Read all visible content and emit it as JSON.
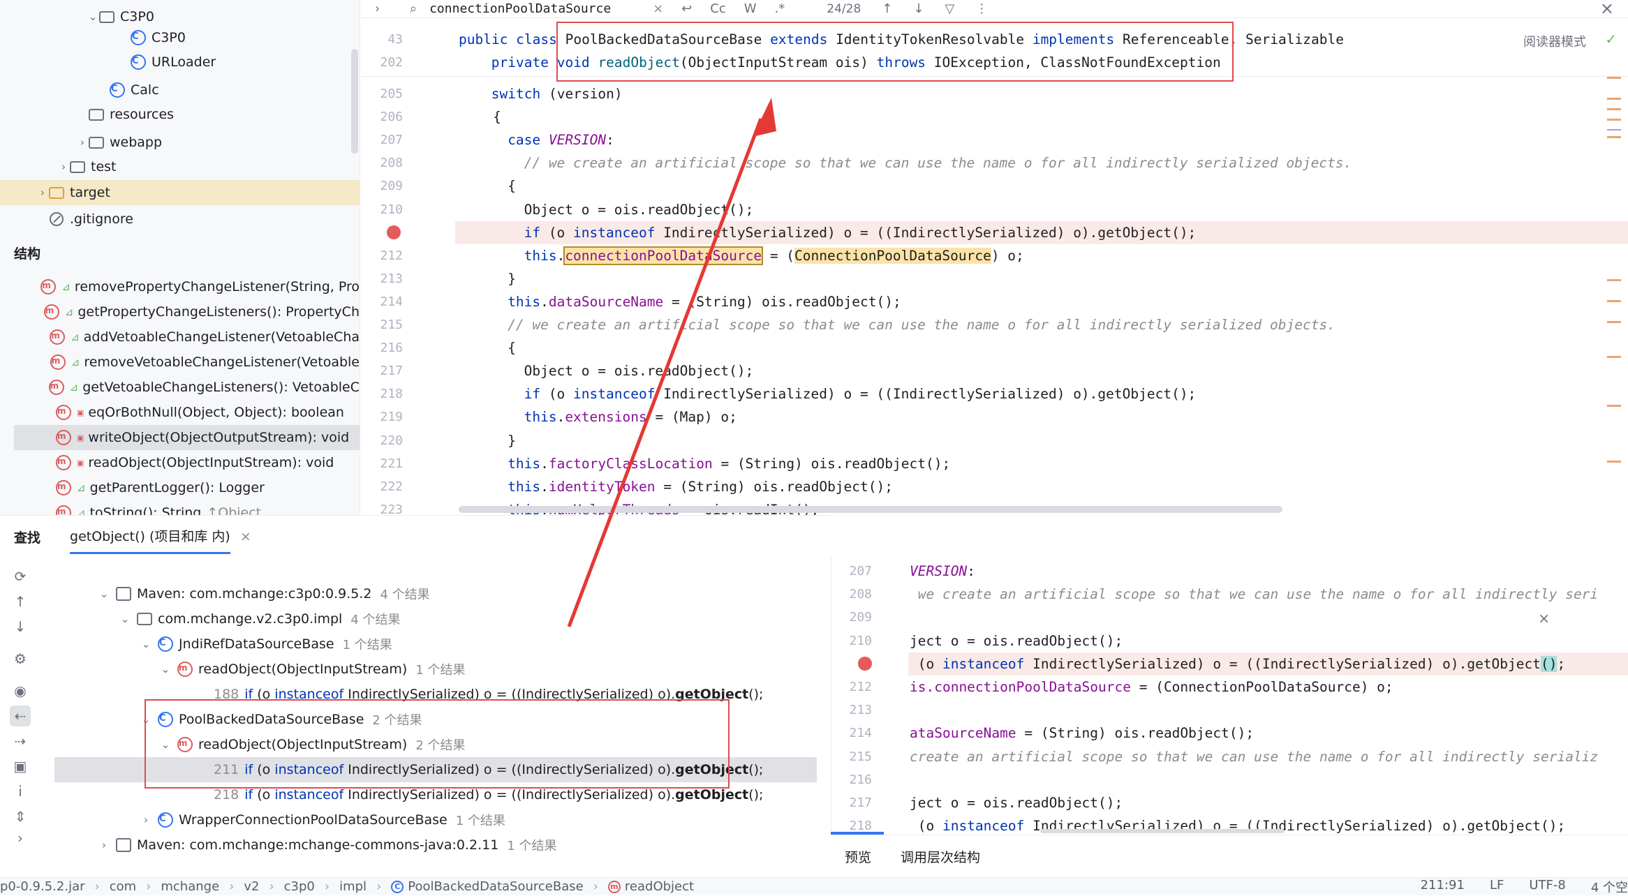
{
  "project_tree": [
    {
      "label": "C3P0",
      "type": "package",
      "indent": 150,
      "chev": "⌄"
    },
    {
      "label": "C3P0",
      "type": "class",
      "indent": 195,
      "chev": ""
    },
    {
      "label": "URLoader",
      "type": "class",
      "indent": 195,
      "chev": ""
    },
    {
      "label": "Calc",
      "type": "class",
      "indent": 165,
      "chev": ""
    },
    {
      "label": "resources",
      "type": "folder",
      "indent": 135,
      "chev": ""
    },
    {
      "label": "webapp",
      "type": "folder",
      "indent": 135,
      "chev": "›"
    },
    {
      "label": "test",
      "type": "folder",
      "indent": 108,
      "chev": "›"
    },
    {
      "label": "target",
      "type": "folder-orange",
      "indent": 78,
      "chev": "›",
      "selected": true
    },
    {
      "label": ".gitignore",
      "type": "git",
      "indent": 78,
      "chev": ""
    }
  ],
  "structure": {
    "title": "结构",
    "items": [
      {
        "label": "removePropertyChangeListener(String, Pro",
        "vis": "pub"
      },
      {
        "label": "getPropertyChangeListeners(): PropertyCh",
        "vis": "pub"
      },
      {
        "label": "addVetoableChangeListener(VetoableCha",
        "vis": "pub"
      },
      {
        "label": "removeVetoableChangeListener(Vetoable",
        "vis": "pub"
      },
      {
        "label": "getVetoableChangeListeners(): VetoableC",
        "vis": "pub"
      },
      {
        "label": "eqOrBothNull(Object, Object): boolean",
        "vis": "prv"
      },
      {
        "label": "writeObject(ObjectOutputStream): void",
        "vis": "prv",
        "selected": true
      },
      {
        "label": "readObject(ObjectInputStream): void",
        "vis": "prv"
      },
      {
        "label": "getParentLogger(): Logger",
        "vis": "pub"
      },
      {
        "label": "toString(): String",
        "vis": "pub",
        "suffix": "↑Object"
      }
    ]
  },
  "search": {
    "query": "connectionPoolDataSource",
    "count": "24/28",
    "opts": [
      "Cc",
      "W",
      ".*"
    ],
    "reader_mode": "阅读器模式"
  },
  "sticky": [
    {
      "ln": "43",
      "html": "<span class=\"kw\">public class</span> PoolBackedDataSourceBase <span class=\"kw\">extends</span> IdentityTokenResolvable <span class=\"kw\">implements</span> Referenceable, Serializable",
      "indent": 0
    },
    {
      "ln": "202",
      "html": "<span class=\"kw\">private void</span> <span class=\"mcall\">readObject</span>(ObjectInputStream ois) <span class=\"kw\">throws</span> IOException, ClassNotFoundException",
      "indent": 2
    }
  ],
  "code": [
    {
      "ln": "205",
      "html": "<span class=\"kw\">switch</span> (version)",
      "indent": 4
    },
    {
      "ln": "206",
      "html": "{",
      "indent": 4.2
    },
    {
      "ln": "207",
      "html": "<span class=\"kw\">case</span> <span class=\"const\">VERSION</span>:",
      "indent": 6
    },
    {
      "ln": "208",
      "html": "<span class=\"cm\">// we create an artificial scope so that we can use the name o for all indirectly serialized objects.</span>",
      "indent": 8
    },
    {
      "ln": "209",
      "html": "{",
      "indent": 6
    },
    {
      "ln": "210",
      "html": "Object o = ois.readObject();",
      "indent": 8
    },
    {
      "ln": "",
      "html": "<span class=\"kw\">if</span> (o <span class=\"kw\">instanceof</span> IndirectlySerialized) o = ((IndirectlySerialized) o).getObject();",
      "indent": 8,
      "breakpoint": true
    },
    {
      "ln": "212",
      "html": "<span class=\"kw\">this</span>.<span class=\"hlbox fld\">connectionPoolDataSource</span> = (<span class=\"hl\">ConnectionPoolDataSource</span>) o;",
      "indent": 8
    },
    {
      "ln": "213",
      "html": "}",
      "indent": 6
    },
    {
      "ln": "214",
      "html": "<span class=\"kw\">this</span>.<span class=\"fld\">dataSourceName</span> = (String) ois.readObject();",
      "indent": 6
    },
    {
      "ln": "215",
      "html": "<span class=\"cm\">// we create an artificial scope so that we can use the name o for all indirectly serialized objects.</span>",
      "indent": 6
    },
    {
      "ln": "216",
      "html": "{",
      "indent": 6
    },
    {
      "ln": "217",
      "html": "Object o = ois.readObject();",
      "indent": 8
    },
    {
      "ln": "218",
      "html": "<span class=\"kw\">if</span> (o <span class=\"kw\">instanceof</span> IndirectlySerialized) o = ((IndirectlySerialized) o).getObject();",
      "indent": 8
    },
    {
      "ln": "219",
      "html": "<span class=\"kw\">this</span>.<span class=\"fld\">extensions</span> = (Map) o;",
      "indent": 8
    },
    {
      "ln": "220",
      "html": "}",
      "indent": 6
    },
    {
      "ln": "221",
      "html": "<span class=\"kw\">this</span>.<span class=\"fld\">factoryClassLocation</span> = (String) ois.readObject();",
      "indent": 6
    },
    {
      "ln": "222",
      "html": "<span class=\"kw\">this</span>.<span class=\"fld\">identityToken</span> = (String) ois.readObject();",
      "indent": 6
    },
    {
      "ln": "223",
      "html": "<span class=\"kw\">this</span>.<span class=\"fld\">numHelperThreads</span> = ois.readInt();",
      "indent": 6
    }
  ],
  "find": {
    "title": "查找",
    "tab": "getObject() (项目和库 内)",
    "results": [
      {
        "indent": 80,
        "chev": "⌄",
        "icon": "mvn",
        "label": "Maven: com.mchange:c3p0:0.9.5.2",
        "count": "4 个结果"
      },
      {
        "indent": 110,
        "chev": "⌄",
        "icon": "pkg",
        "label": "com.mchange.v2.c3p0.impl",
        "count": "4 个结果"
      },
      {
        "indent": 140,
        "chev": "⌄",
        "icon": "class",
        "label": "JndiRefDataSourceBase",
        "count": "1 个结果"
      },
      {
        "indent": 168,
        "chev": "⌄",
        "icon": "method",
        "label": "readObject(ObjectInputStream)",
        "count": "1 个结果"
      },
      {
        "indent": 220,
        "chev": "",
        "icon": "usage",
        "lnum": "188",
        "label": "",
        "count": ""
      },
      {
        "indent": 140,
        "chev": "⌄",
        "icon": "class",
        "label": "PoolBackedDataSourceBase",
        "count": "2 个结果"
      },
      {
        "indent": 168,
        "chev": "⌄",
        "icon": "method",
        "label": "readObject(ObjectInputStream)",
        "count": "2 个结果"
      },
      {
        "indent": 220,
        "chev": "",
        "icon": "usage",
        "lnum": "211",
        "label": "",
        "count": "",
        "selected": true
      },
      {
        "indent": 220,
        "chev": "",
        "icon": "usage",
        "lnum": "218",
        "label": "",
        "count": ""
      },
      {
        "indent": 140,
        "chev": "›",
        "icon": "class",
        "label": "WrapperConnectionPoolDataSourceBase",
        "count": "1 个结果"
      },
      {
        "indent": 80,
        "chev": "›",
        "icon": "mvn",
        "label": "Maven: com.mchange:mchange-commons-java:0.2.11",
        "count": "1 个结果"
      }
    ],
    "usage_html": "<span class=\"kw\">if</span> (o <span class=\"kw\">instanceof</span> IndirectlySerialized) o = ((IndirectlySerialized) o).<span class=\"bold\">getObject</span>();"
  },
  "preview": {
    "lines": [
      {
        "ln": "207",
        "html": "<span class=\"const\">VERSION</span>:"
      },
      {
        "ln": "208",
        "html": "<span class=\"cm\"> we create an artificial scope so that we can use the name o for all indirectly seri</span>"
      },
      {
        "ln": "209",
        "html": ""
      },
      {
        "ln": "210",
        "html": "ject o = ois.readObject();"
      },
      {
        "ln": "",
        "html": " (o <span class=\"kw\">instanceof</span> IndirectlySerialized) o = ((IndirectlySerialized) o).getObject<span style=\"background:#a8e0dc\">()</span>;",
        "breakpoint": true
      },
      {
        "ln": "212",
        "html": "<span class=\"fld\">is.connectionPoolDataSource</span> = (ConnectionPoolDataSource) o;"
      },
      {
        "ln": "213",
        "html": ""
      },
      {
        "ln": "214",
        "html": "<span class=\"fld\">ataSourceName</span> = (String) ois.readObject();"
      },
      {
        "ln": "215",
        "html": "<span class=\"cm\">create an artificial scope so that we can use the name o for all indirectly serializ</span>"
      },
      {
        "ln": "216",
        "html": ""
      },
      {
        "ln": "217",
        "html": "ject o = ois.readObject();"
      },
      {
        "ln": "218",
        "html": " (o <span class=\"kw\">instanceof</span> IndirectlySerialized) o = ((IndirectlySerialized) o).getObject();"
      }
    ],
    "tabs": [
      "预览",
      "调用层次结构"
    ]
  },
  "status": {
    "crumbs": [
      "p0-0.9.5.2.jar",
      "com",
      "mchange",
      "v2",
      "c3p0",
      "impl",
      "PoolBackedDataSourceBase",
      "readObject"
    ],
    "position": "211:91",
    "line_ending": "LF",
    "encoding": "UTF-8",
    "indent": "4 个空"
  }
}
